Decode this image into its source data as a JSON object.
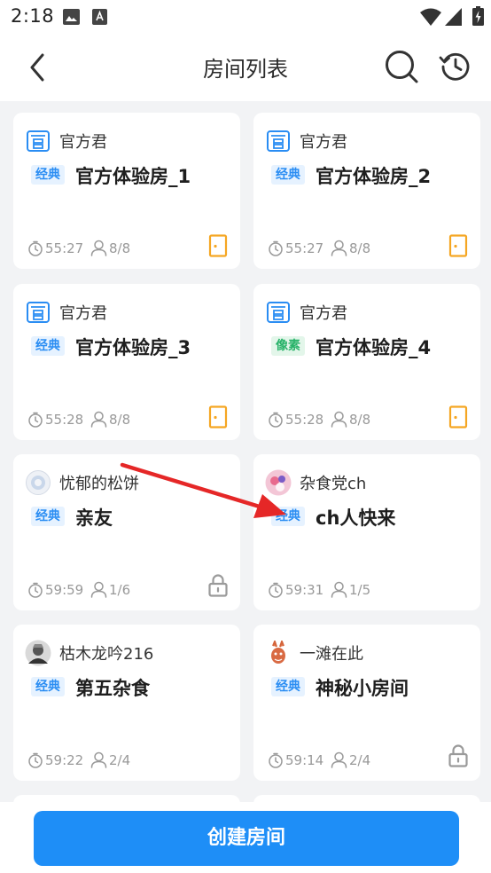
{
  "status_bar": {
    "time": "2:18",
    "left_icons": [
      "image-icon",
      "a-box-icon"
    ],
    "right_icons": [
      "wifi-icon",
      "signal-icon",
      "battery-icon"
    ]
  },
  "header": {
    "title": "房间列表",
    "back_icon": "chevron-left-icon",
    "search_icon": "search-icon",
    "history_icon": "history-icon"
  },
  "colors": {
    "primary": "#1e8ef7",
    "tag_blue": "#2a8df3",
    "tag_green": "#29b36a",
    "door": "#f5a623",
    "background": "#f2f3f5"
  },
  "rooms": [
    {
      "owner": "官方君",
      "avatar": "official-icon",
      "tag": "经典",
      "name": "官方体验房_1",
      "time": "55:27",
      "players": "8/8",
      "status_icon": "door-icon"
    },
    {
      "owner": "官方君",
      "avatar": "official-icon",
      "tag": "经典",
      "name": "官方体验房_2",
      "time": "55:27",
      "players": "8/8",
      "status_icon": "door-icon"
    },
    {
      "owner": "官方君",
      "avatar": "official-icon",
      "tag": "经典",
      "name": "官方体验房_3",
      "time": "55:28",
      "players": "8/8",
      "status_icon": "door-icon"
    },
    {
      "owner": "官方君",
      "avatar": "official-icon",
      "tag": "像素",
      "name": "官方体验房_4",
      "time": "55:28",
      "players": "8/8",
      "status_icon": "door-icon"
    },
    {
      "owner": "忧郁的松饼",
      "avatar": "user-avatar",
      "tag": "经典",
      "name": "亲友",
      "time": "59:59",
      "players": "1/6",
      "status_icon": "lock-icon"
    },
    {
      "owner": "杂食党ch",
      "avatar": "user-avatar",
      "tag": "经典",
      "name": "ch人快来",
      "time": "59:31",
      "players": "1/5",
      "status_icon": "none"
    },
    {
      "owner": "枯木龙吟216",
      "avatar": "user-avatar",
      "tag": "经典",
      "name": "第五杂食",
      "time": "59:22",
      "players": "2/4",
      "status_icon": "none"
    },
    {
      "owner": "一滩在此",
      "avatar": "user-avatar",
      "tag": "经典",
      "name": "神秘小房间",
      "time": "59:14",
      "players": "2/4",
      "status_icon": "lock-icon"
    }
  ],
  "create_button": {
    "label": "创建房间"
  }
}
